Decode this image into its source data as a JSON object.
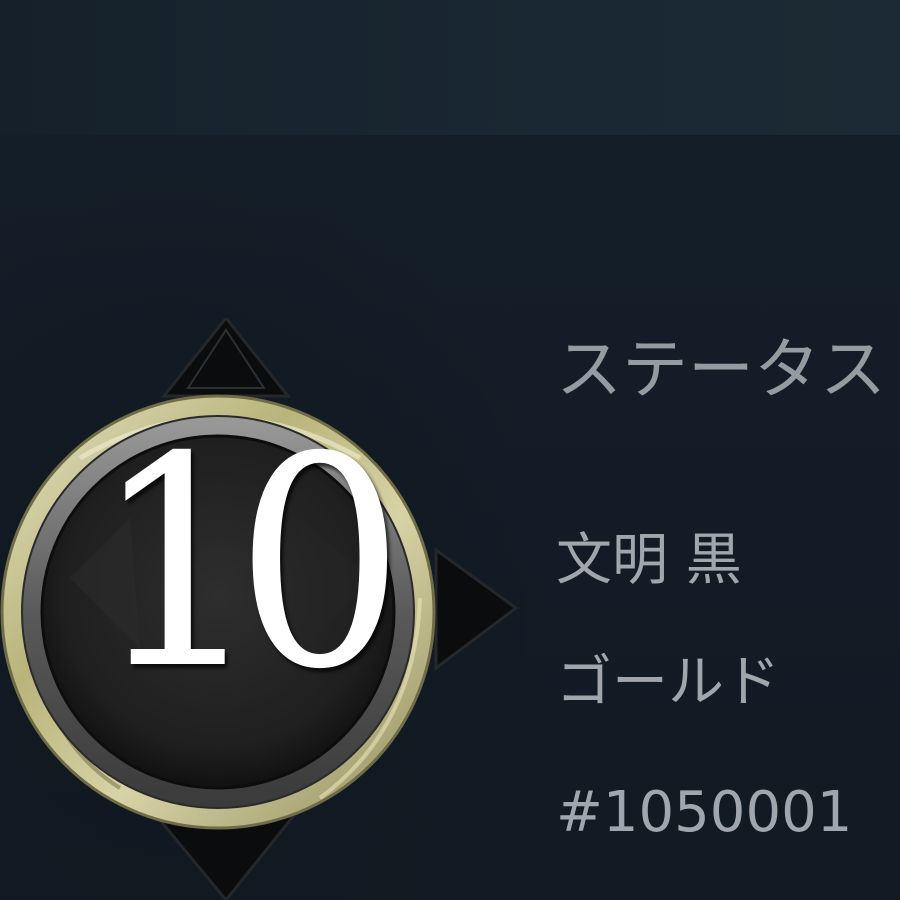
{
  "status": {
    "title": "ステータス"
  },
  "player": {
    "name": "文明 黒",
    "rank": "ゴールド",
    "id": "#1050001"
  },
  "badge": {
    "level": "10",
    "icon": "level-badge-icon"
  },
  "colors": {
    "background": "#141d27",
    "top_bar": "#1a2833",
    "text": "#9aa1a6",
    "badge_rim": "#c9c48e",
    "badge_inner": "#262626",
    "number": "#ffffff"
  }
}
